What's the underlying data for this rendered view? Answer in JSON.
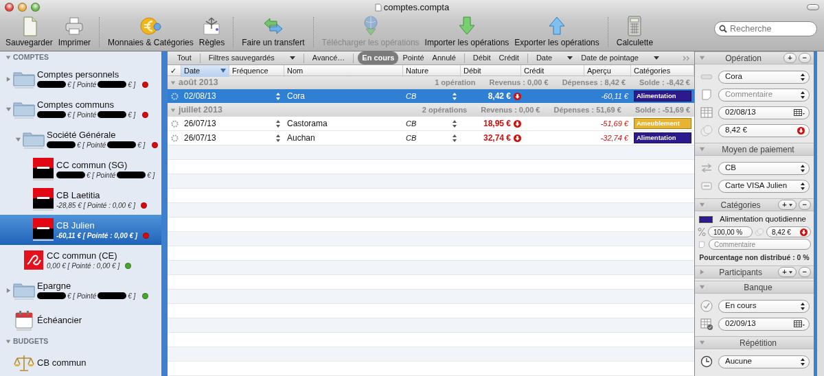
{
  "window": {
    "title": "comptes.compta"
  },
  "toolbar": {
    "groups": [
      [
        {
          "kind": "save",
          "label": "Sauvegarder",
          "disabled": false
        },
        {
          "kind": "print",
          "label": "Imprimer",
          "disabled": false
        }
      ],
      [
        {
          "kind": "currency",
          "label": "Monnaies & Catégories",
          "disabled": false
        },
        {
          "kind": "rules",
          "label": "Règles",
          "disabled": false
        }
      ],
      [
        {
          "kind": "transfer",
          "label": "Faire un transfert",
          "disabled": false
        }
      ],
      [
        {
          "kind": "download-web",
          "label": "Télécharger les opérations",
          "disabled": true
        },
        {
          "kind": "import",
          "label": "Importer les opérations",
          "disabled": false
        },
        {
          "kind": "export",
          "label": "Exporter les opérations",
          "disabled": false
        }
      ],
      [
        {
          "kind": "calculator",
          "label": "Calculette",
          "disabled": false
        }
      ]
    ],
    "search": {
      "placeholder": "Recherche"
    }
  },
  "sidebar": {
    "sections": [
      {
        "title": "COMPTES",
        "expanded": true,
        "items": [
          {
            "kind": "folder",
            "name": "Comptes personnels",
            "expanded": false,
            "selected": false,
            "redacted": true,
            "balance_parts": [
              "€ [ Pointé",
              "€ ]"
            ],
            "color": "#d40c0c"
          },
          {
            "kind": "folder",
            "name": "Comptes communs",
            "expanded": true,
            "selected": false,
            "redacted": true,
            "balance_parts": [
              "€ [ Pointé",
              "€ ]"
            ],
            "color": "#d40c0c",
            "children": [
              {
                "kind": "folder",
                "name": "Société Générale",
                "expanded": true,
                "selected": false,
                "redacted": true,
                "balance_parts": [
                  "€ [ Pointé",
                  "€ ]"
                ],
                "color": "#d40c0c",
                "children": [
                  {
                    "kind": "bank-sg",
                    "name": "CC commun (SG)",
                    "selected": false,
                    "redacted": true,
                    "balance_parts": [
                      "€ [ Pointé",
                      "€ ]"
                    ]
                  },
                  {
                    "kind": "bank-sg",
                    "name": "CB Laetitia",
                    "selected": false,
                    "balance": "-28,85 € [ Pointé : 0,00 € ]",
                    "color": "#d40c0c"
                  },
                  {
                    "kind": "bank-sg",
                    "name": "CB Julien",
                    "selected": true,
                    "balance": "-60,11 € [ Pointé : 0,00 € ]",
                    "color": "#d40c0c"
                  }
                ]
              },
              {
                "kind": "bank-ce",
                "name": "CC commun (CE)",
                "selected": false,
                "balance": "0,00 € [ Pointé : 0,00 € ]",
                "color": "#4aa52a"
              }
            ]
          },
          {
            "kind": "folder",
            "name": "Epargne",
            "expanded": false,
            "selected": false,
            "redacted": true,
            "balance_parts": [
              "€ [ Pointé",
              "€ ]"
            ],
            "color": "#4aa52a"
          },
          {
            "kind": "schedule",
            "name": "Échéancier",
            "selected": false
          }
        ]
      },
      {
        "title": "BUDGETS",
        "expanded": true,
        "items": [
          {
            "kind": "budget",
            "name": "CB commun",
            "selected": false
          }
        ]
      }
    ]
  },
  "filter_bar": {
    "groups": [
      [
        {
          "label": "Tout"
        }
      ],
      [
        {
          "label": "Filtres sauvegardés",
          "dropdown": true
        }
      ],
      [
        {
          "label": "Avancé…"
        }
      ],
      [
        {
          "label": "En cours",
          "selected": true
        },
        {
          "label": "Pointé",
          "selected": false
        },
        {
          "label": "Annulé",
          "selected": false
        }
      ],
      [
        {
          "label": "Débit",
          "selected": false
        },
        {
          "label": "Crédit",
          "selected": false
        }
      ],
      [
        {
          "label": "Date",
          "dropdown": true
        },
        {
          "label": "Date de pointage",
          "dropdown": true
        }
      ]
    ]
  },
  "table": {
    "columns": [
      {
        "label": "✓",
        "sorted": false
      },
      {
        "label": "Date",
        "sorted": true
      },
      {
        "label": "Fréquence",
        "sorted": false
      },
      {
        "label": "Nom",
        "sorted": false
      },
      {
        "label": "Nature",
        "sorted": false
      },
      {
        "label": "Débit",
        "sorted": false
      },
      {
        "label": "Crédit",
        "sorted": false
      },
      {
        "label": "Aperçu",
        "sorted": false
      },
      {
        "label": "Catégories",
        "sorted": false
      }
    ],
    "groups": [
      {
        "label": "août 2013",
        "expanded": true,
        "count": "1 opération",
        "revenus": "Revenus : 0,00 €",
        "depenses": "Dépenses : 8,42 €",
        "solde": "Solde : -8,42 €",
        "rows": [
          {
            "date": "02/08/13",
            "name": "Cora",
            "nature": "CB",
            "debit": "8,42 €",
            "balance": "-60,11 €",
            "category": {
              "label": "Alimentation",
              "color": "#2c1a8c"
            },
            "selected": true
          }
        ]
      },
      {
        "label": "juillet 2013",
        "expanded": true,
        "count": "2 opérations",
        "revenus": "Revenus : 0,00 €",
        "depenses": "Dépenses : 51,69 €",
        "solde": "Solde : -51,69 €",
        "rows": [
          {
            "date": "26/07/13",
            "name": "Castorama",
            "nature": "CB",
            "debit": "18,95 €",
            "balance": "-51,69 €",
            "category": {
              "label": "Ameublement",
              "color": "#e6b42e"
            },
            "selected": false
          },
          {
            "date": "26/07/13",
            "name": "Auchan",
            "nature": "CB",
            "debit": "32,74 €",
            "balance": "-32,74 €",
            "category": {
              "label": "Alimentation",
              "color": "#2c1a8c"
            },
            "selected": false
          }
        ]
      }
    ]
  },
  "inspector": {
    "sections": [
      {
        "title": "Opération",
        "expanded": true,
        "buttons": [
          {
            "label": "+",
            "dropdown": false
          },
          {
            "label": "−",
            "dropdown": false
          }
        ],
        "fields": [
          {
            "kind": "select",
            "value": "Cora"
          },
          {
            "kind": "select",
            "placeholder": "Commentaire"
          },
          {
            "kind": "date",
            "value": "02/08/13"
          },
          {
            "kind": "amount",
            "value": "8,42 €"
          }
        ]
      },
      {
        "title": "Moyen de paiement",
        "expanded": true,
        "fields": [
          {
            "kind": "select",
            "value": "CB"
          },
          {
            "kind": "select",
            "value": "Carte VISA Julien"
          }
        ]
      },
      {
        "title": "Catégories",
        "expanded": true,
        "buttons": [
          {
            "label": "+",
            "dropdown": true
          },
          {
            "label": "−",
            "dropdown": false
          }
        ],
        "fields": [
          {
            "kind": "category",
            "label": "Alimentation quotidienne",
            "color": "#2c1a8c"
          },
          {
            "kind": "split",
            "percent": "100,00 %",
            "amount": "8,42 €"
          },
          {
            "kind": "note",
            "placeholder": "Commentaire"
          },
          {
            "kind": "summary",
            "text": "Pourcentage non distribué : 0 %"
          }
        ]
      },
      {
        "title": "Participants",
        "expanded": false,
        "buttons": [
          {
            "label": "+",
            "dropdown": true
          },
          {
            "label": "−",
            "dropdown": false
          }
        ]
      },
      {
        "title": "Banque",
        "expanded": true,
        "fields": [
          {
            "kind": "select",
            "value": "En cours"
          },
          {
            "kind": "date",
            "value": "02/09/13"
          }
        ]
      },
      {
        "title": "Répétition",
        "expanded": true,
        "fields": [
          {
            "kind": "select",
            "value": "Aucune"
          }
        ]
      }
    ]
  }
}
